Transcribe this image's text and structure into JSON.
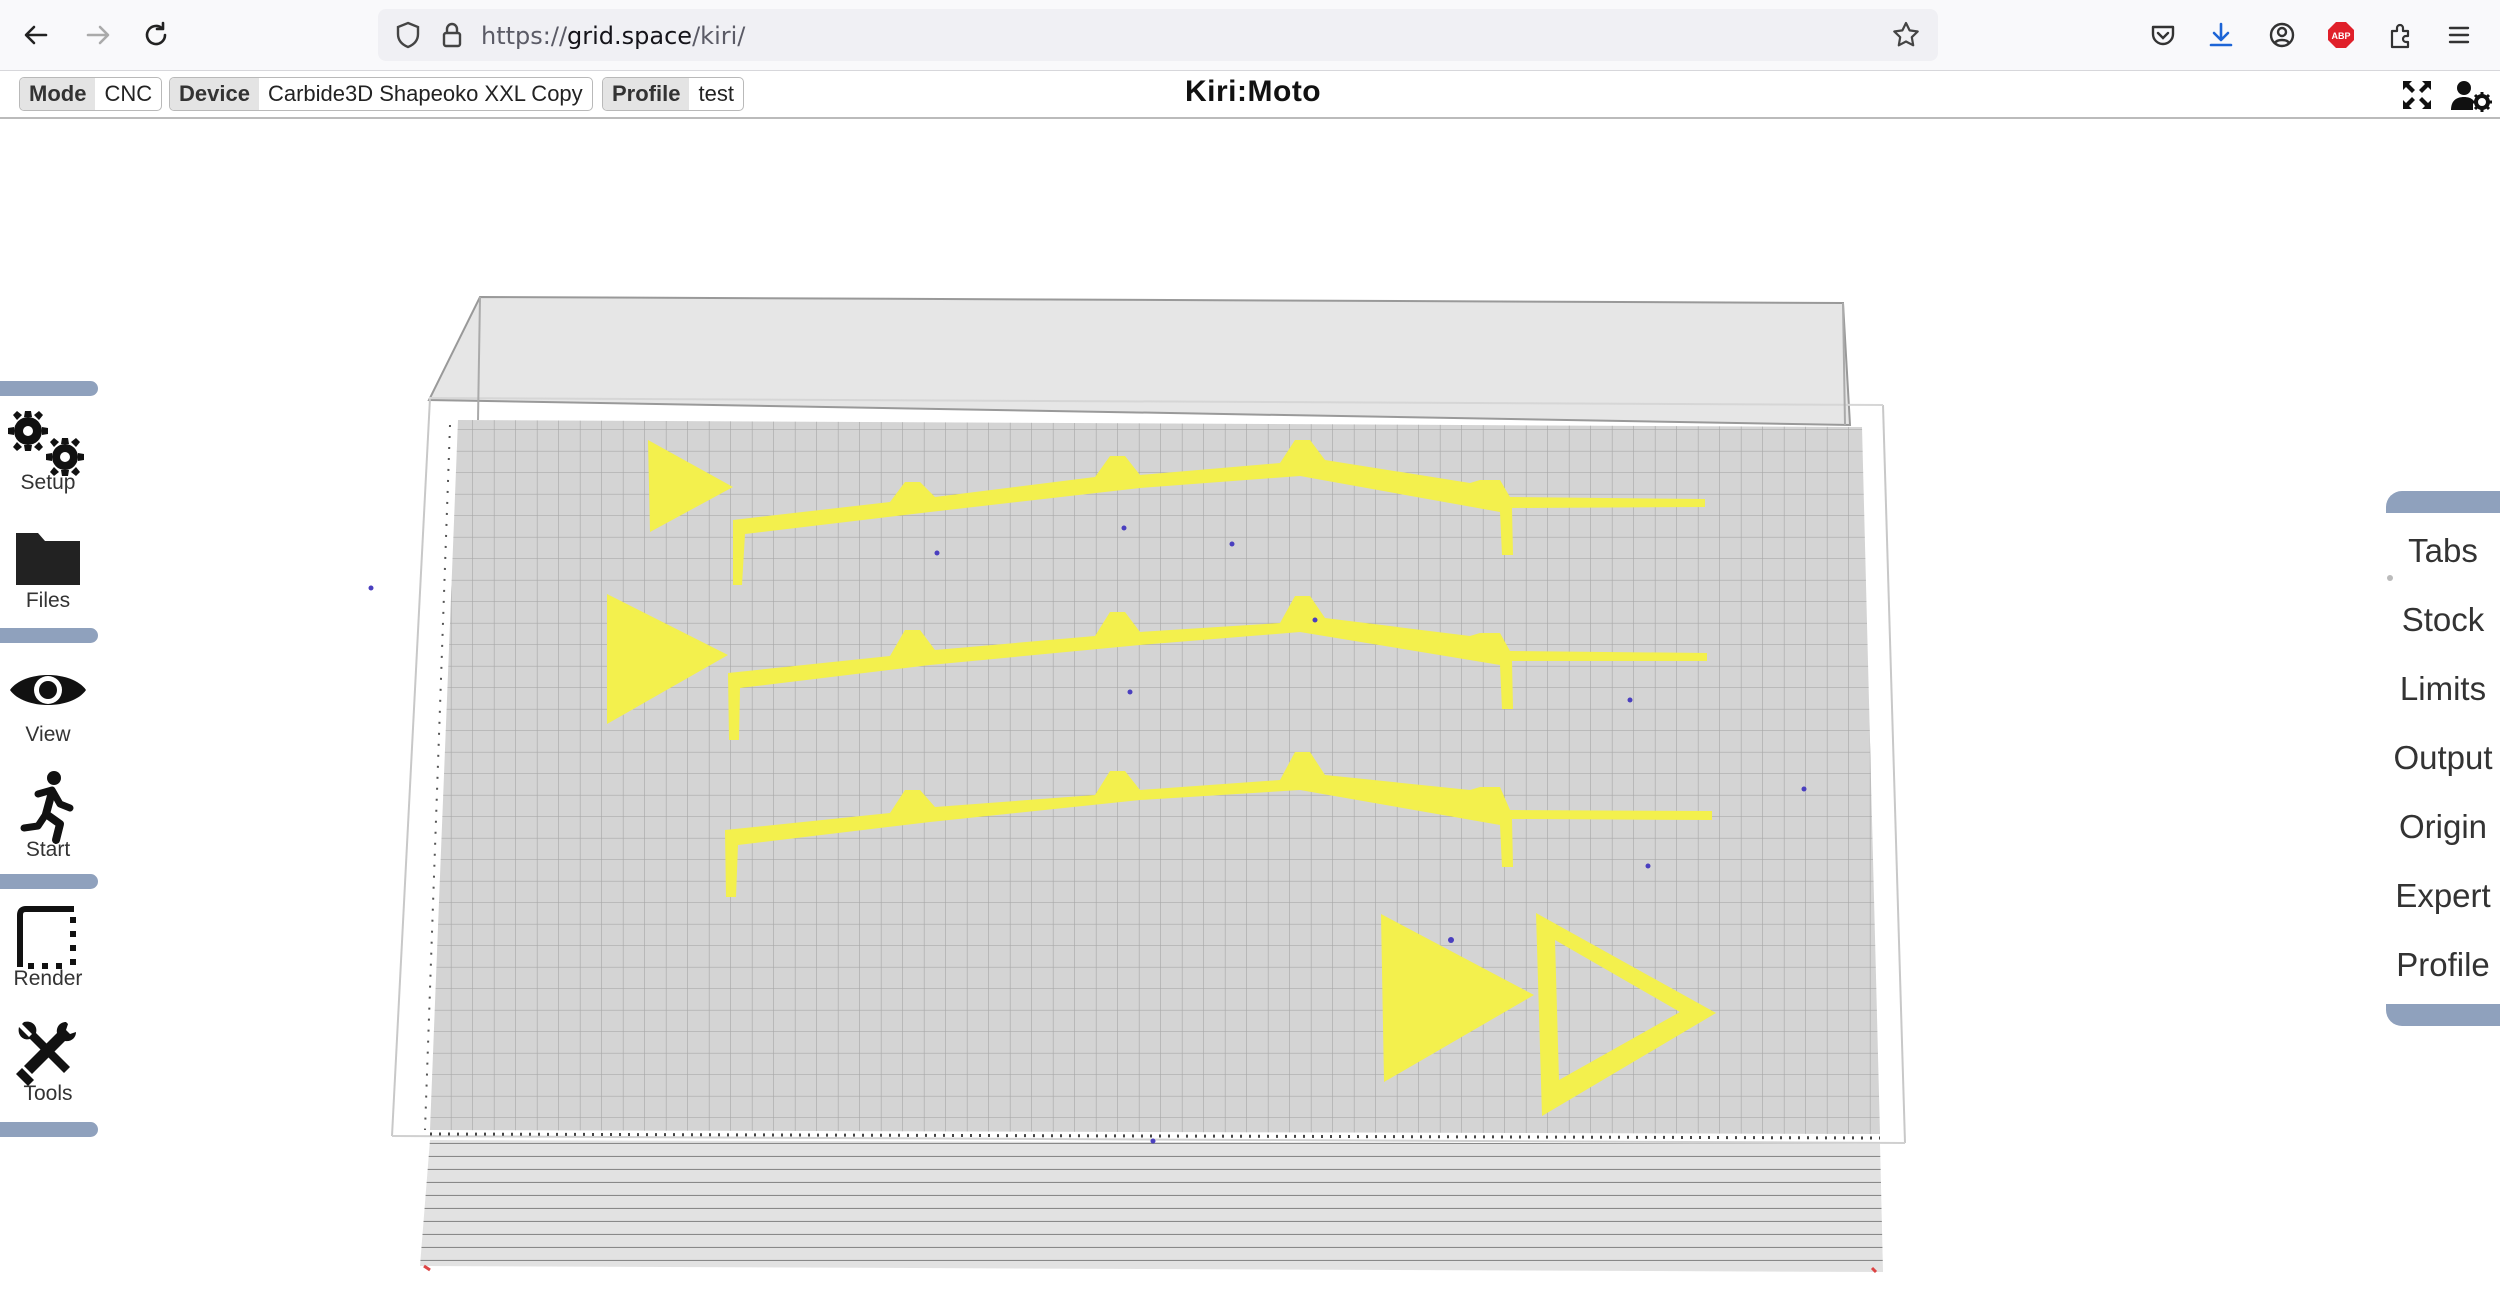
{
  "browser": {
    "url_prefix": "https://",
    "url_host": "grid.space",
    "url_path": "/kiri/"
  },
  "toolbar": {
    "mode_label": "Mode",
    "mode_value": "CNC",
    "device_label": "Device",
    "device_value": "Carbide3D Shapeoko XXL Copy",
    "profile_label": "Profile",
    "profile_value": "test",
    "brand": "Kiri:Moto"
  },
  "left_menu": [
    {
      "label": "Setup",
      "icon": "gears-icon"
    },
    {
      "label": "Files",
      "icon": "folder-icon"
    },
    {
      "label": "View",
      "icon": "eye-icon"
    },
    {
      "label": "Start",
      "icon": "running-person-icon"
    },
    {
      "label": "Render",
      "icon": "render-frame-icon"
    },
    {
      "label": "Tools",
      "icon": "tools-icon"
    }
  ],
  "right_menu": [
    "Tabs",
    "Stock",
    "Limits",
    "Output",
    "Origin",
    "Expert",
    "Profile"
  ],
  "colors": {
    "accent": "#8fa1bd",
    "part_yellow": "#f3f04d",
    "bed_gray": "#d4d4d4",
    "grid_line": "#a9a9a9"
  }
}
